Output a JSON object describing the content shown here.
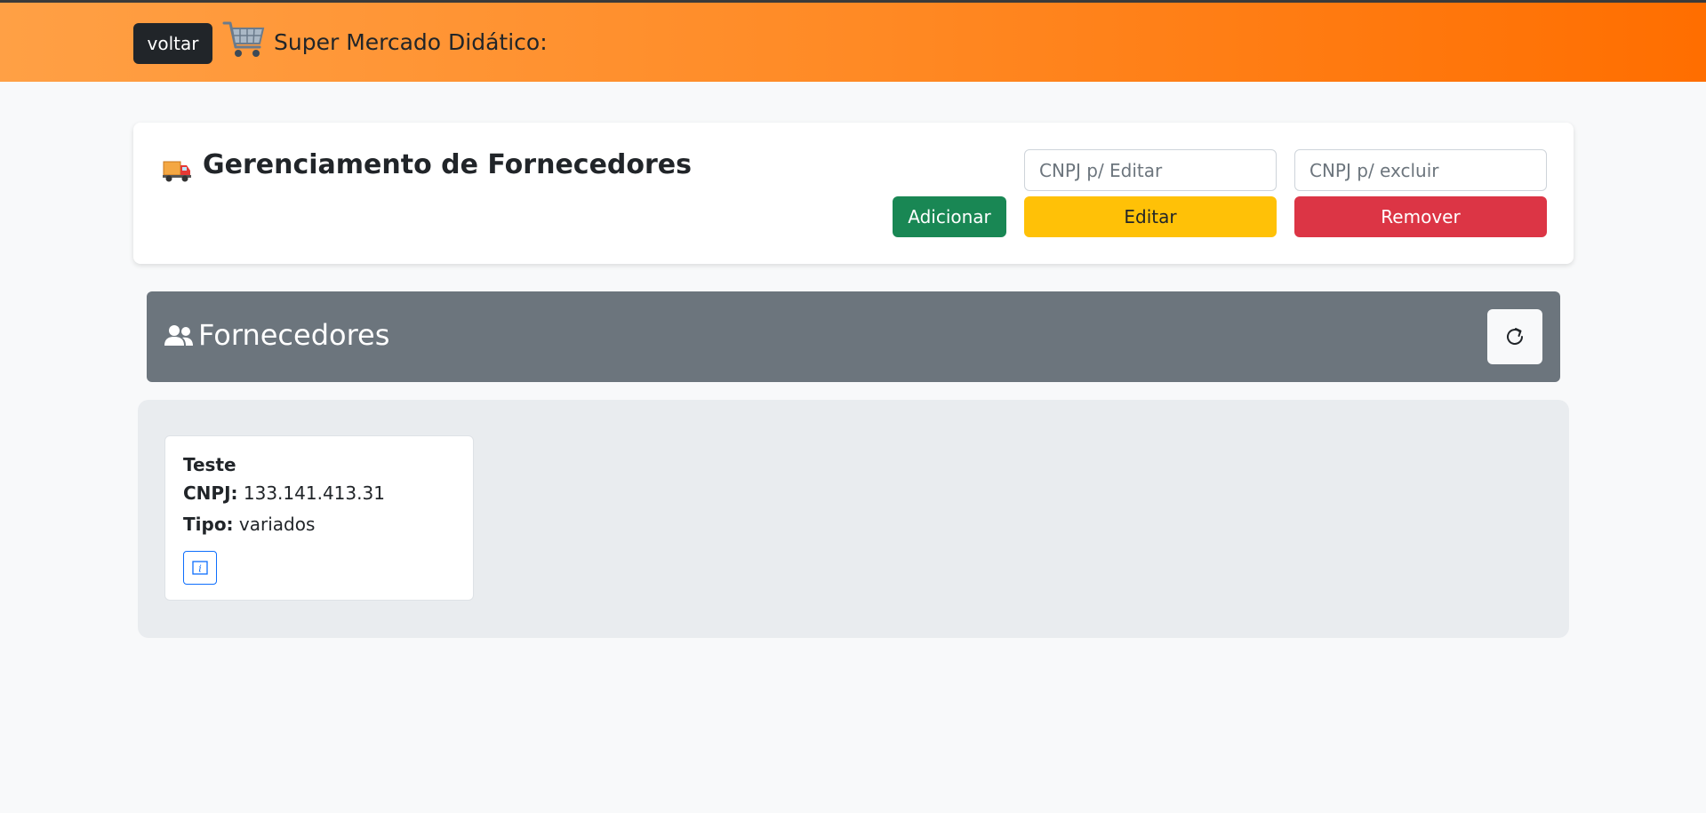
{
  "navbar": {
    "back_label": "voltar",
    "brand": "Super Mercado Didático:",
    "icon": "shopping-cart-icon"
  },
  "management": {
    "title": "Gerenciamento de Fornecedores",
    "icon": "delivery-truck-icon",
    "edit_input_placeholder": "CNPJ p/ Editar",
    "delete_input_placeholder": "CNPJ p/ excluir",
    "add_label": "Adicionar",
    "edit_label": "Editar",
    "remove_label": "Remover"
  },
  "list": {
    "title": "Fornecedores",
    "icon": "users-icon",
    "refresh_icon": "refresh-icon"
  },
  "suppliers": [
    {
      "name": "Teste",
      "cnpj_label": "CNPJ:",
      "cnpj": "133.141.413.31",
      "tipo_label": "Tipo:",
      "tipo": "variados",
      "info_icon": "info-icon"
    }
  ],
  "colors": {
    "navbar_gradient_start": "#ffa045",
    "navbar_gradient_end": "#ff6e00",
    "add": "#198754",
    "edit": "#ffc107",
    "remove": "#dc3545",
    "list_header": "#6c757d",
    "info": "#0d6efd"
  }
}
